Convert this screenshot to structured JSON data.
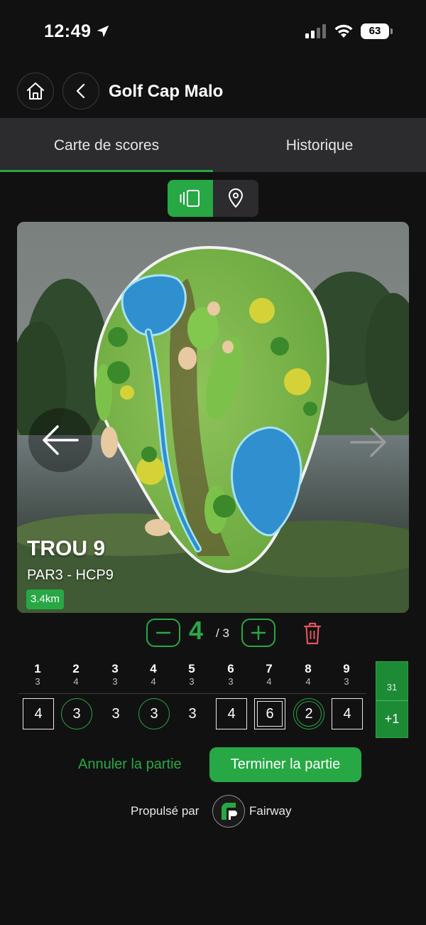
{
  "status_bar": {
    "time": "12:49",
    "battery": "63"
  },
  "header": {
    "title": "Golf Cap Malo"
  },
  "tabs": [
    {
      "label": "Carte de scores",
      "active": true
    },
    {
      "label": "Historique",
      "active": false
    }
  ],
  "view_toggle": {
    "options": [
      "scorecard-view-icon",
      "map-pin-icon"
    ],
    "selected": "scorecard-view-icon"
  },
  "hole": {
    "title": "TROU 9",
    "info": "PAR3 - HCP9",
    "distance": "3.4km"
  },
  "stepper": {
    "score": "4",
    "par": "/ 3"
  },
  "scorecard": {
    "holes": [
      {
        "num": "1",
        "par": "3",
        "score": "4",
        "mark": "box"
      },
      {
        "num": "2",
        "par": "4",
        "score": "3",
        "mark": "circle"
      },
      {
        "num": "3",
        "par": "3",
        "score": "3",
        "mark": "none"
      },
      {
        "num": "4",
        "par": "4",
        "score": "3",
        "mark": "circle"
      },
      {
        "num": "5",
        "par": "3",
        "score": "3",
        "mark": "none"
      },
      {
        "num": "6",
        "par": "3",
        "score": "4",
        "mark": "box"
      },
      {
        "num": "7",
        "par": "4",
        "score": "6",
        "mark": "double-box"
      },
      {
        "num": "8",
        "par": "4",
        "score": "2",
        "mark": "double-circle"
      },
      {
        "num": "9",
        "par": "3",
        "score": "4",
        "mark": "box"
      }
    ],
    "total_par": "31",
    "total_diff": "+1"
  },
  "actions": {
    "cancel_label": "Annuler la partie",
    "finish_label": "Terminer la partie"
  },
  "footer": {
    "powered_label": "Propulsé par",
    "brand": "Fairway"
  },
  "colors": {
    "accent": "#27a844",
    "background": "#111112",
    "tab_bar": "#2c2c2e",
    "trash": "#e0555b"
  }
}
